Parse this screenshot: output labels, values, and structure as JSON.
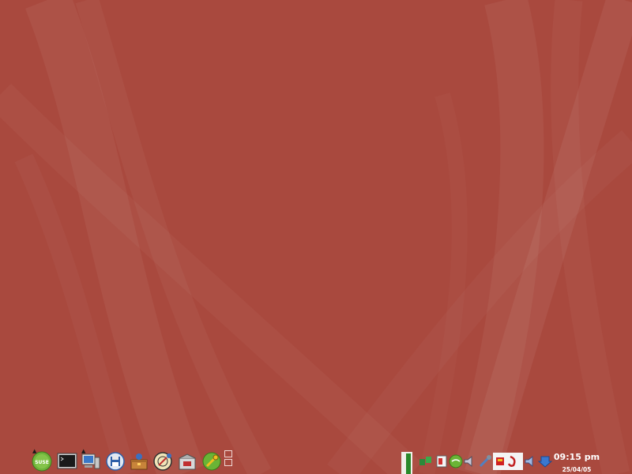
{
  "desktop": {
    "background_color": "#a9493e"
  },
  "taskbar": {
    "launchers": [
      {
        "icon": "suse-menu-icon",
        "label": "SUSE"
      },
      {
        "icon": "terminal-icon"
      },
      {
        "icon": "my-computer-icon"
      },
      {
        "icon": "floppy-disk-icon"
      },
      {
        "icon": "package-manager-icon"
      },
      {
        "icon": "web-browser-icon"
      },
      {
        "icon": "software-install-icon"
      },
      {
        "icon": "control-center-icon"
      }
    ],
    "pager_desktops": 2,
    "tray_icons": [
      "system-monitor-icon",
      "network-icon",
      "clipboard-icon",
      "update-status-icon",
      "volume-icon",
      "tools-icon",
      "power-icon",
      "help-icon",
      "volume-icon",
      "download-icon"
    ],
    "clock": {
      "time": "09:15 pm",
      "date": "25/04/05"
    }
  }
}
